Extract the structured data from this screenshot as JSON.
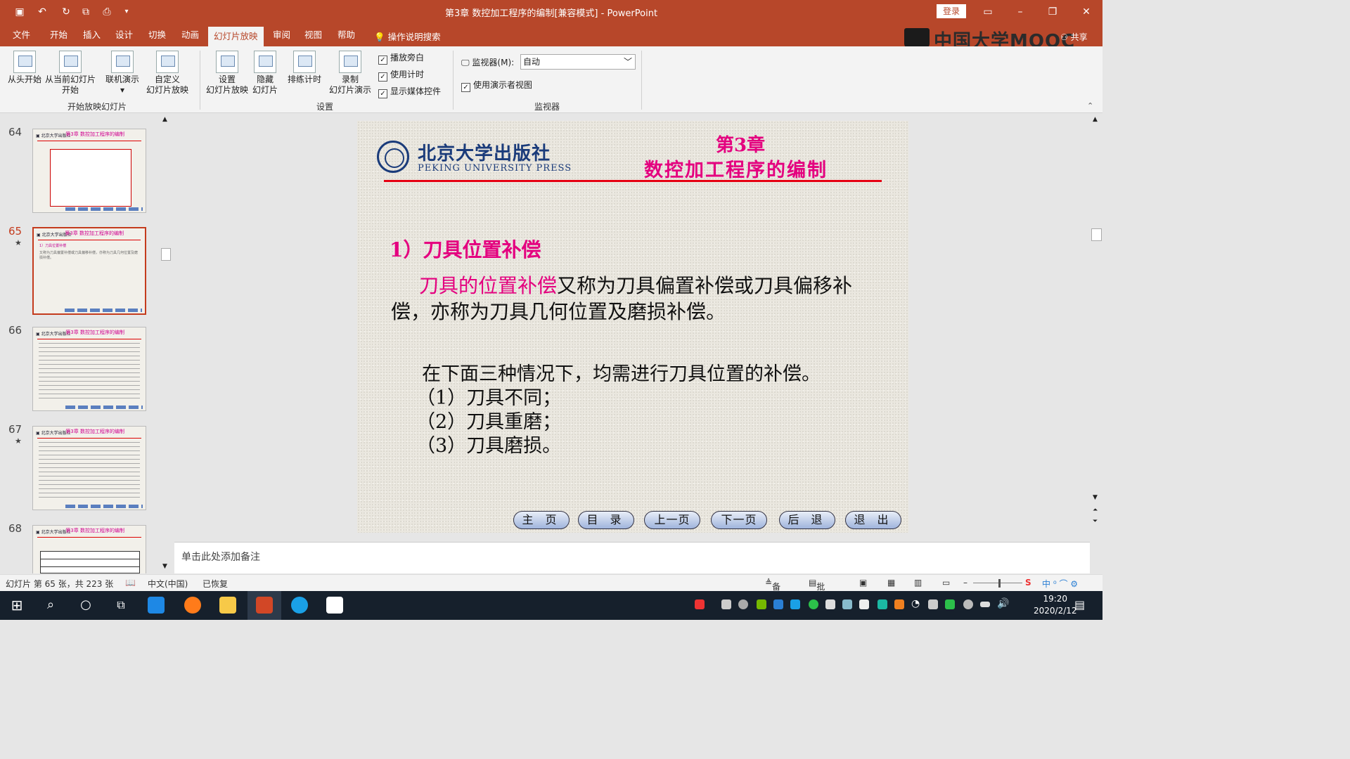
{
  "window": {
    "title": "第3章 数控加工程序的编制[兼容模式] - PowerPoint",
    "login_label": "登录"
  },
  "tabs": [
    "文件",
    "开始",
    "插入",
    "设计",
    "切换",
    "动画",
    "幻灯片放映",
    "审阅",
    "视图",
    "帮助"
  ],
  "active_tab": "幻灯片放映",
  "tell_me": "操作说明搜索",
  "brand": "中国大学MOOC",
  "share_label": "共享",
  "ribbon": {
    "start_group": {
      "from_beginning": "从头开始",
      "from_current_1": "从当前幻灯片",
      "from_current_2": "开始",
      "online_present": "联机演示",
      "custom_1": "自定义",
      "custom_2": "幻灯片放映",
      "label": "开始放映幻灯片"
    },
    "setup_group": {
      "setup_1": "设置",
      "setup_2": "幻灯片放映",
      "hide_1": "隐藏",
      "hide_2": "幻灯片",
      "rehearse": "排练计时",
      "record_1": "录制",
      "record_2": "幻灯片演示",
      "play_narrations": "播放旁白",
      "use_timings": "使用计时",
      "show_media": "显示媒体控件",
      "label": "设置"
    },
    "monitor_group": {
      "monitor_label": "监视器(M):",
      "monitor_value": "自动",
      "presenter_view": "使用演示者视图",
      "label": "监视器"
    }
  },
  "thumbnails": [
    {
      "num": "64",
      "star": "",
      "title": "第3章 数控加工程序的编制"
    },
    {
      "num": "65",
      "star": "★",
      "title": "第3章 数控加工程序的编制"
    },
    {
      "num": "66",
      "star": "",
      "title": "第3章 数控加工程序的编制"
    },
    {
      "num": "67",
      "star": "★",
      "title": "第3章 数控加工程序的编制"
    },
    {
      "num": "68",
      "star": "",
      "title": "第3章 数控加工程序的编制"
    }
  ],
  "slide": {
    "publisher_cn": "北京大学出版社",
    "publisher_en": "PEKING UNIVERSITY PRESS",
    "chapter": "第3章",
    "chapter_title": "数控加工程序的编制",
    "section_title": "1）刀具位置补偿",
    "para1_highlight": "刀具的位置补偿",
    "para1_rest": "又称为刀具偏置补偿或刀具偏移补偿，亦称为刀具几何位置及磨损补偿。",
    "para2": "在下面三种情况下，均需进行刀具位置的补偿。",
    "items": [
      "（1）刀具不同；",
      "（2）刀具重磨；",
      "（3）刀具磨损。"
    ],
    "nav": [
      "主 页",
      "目 录",
      "上一页",
      "下一页",
      "后 退",
      "退 出"
    ]
  },
  "notes_placeholder": "单击此处添加备注",
  "status": {
    "slide_info": "幻灯片 第 65 张，共 223 张",
    "language": "中文(中国)",
    "recovered": "已恢复",
    "notes": "备注",
    "comments": "批注"
  },
  "clock": {
    "time": "19:20",
    "date": "2020/2/12"
  },
  "colors": {
    "accent": "#b7472a",
    "slide_pink": "#e4007f",
    "slide_red": "#e60012",
    "pku_blue": "#1a3b7a"
  }
}
